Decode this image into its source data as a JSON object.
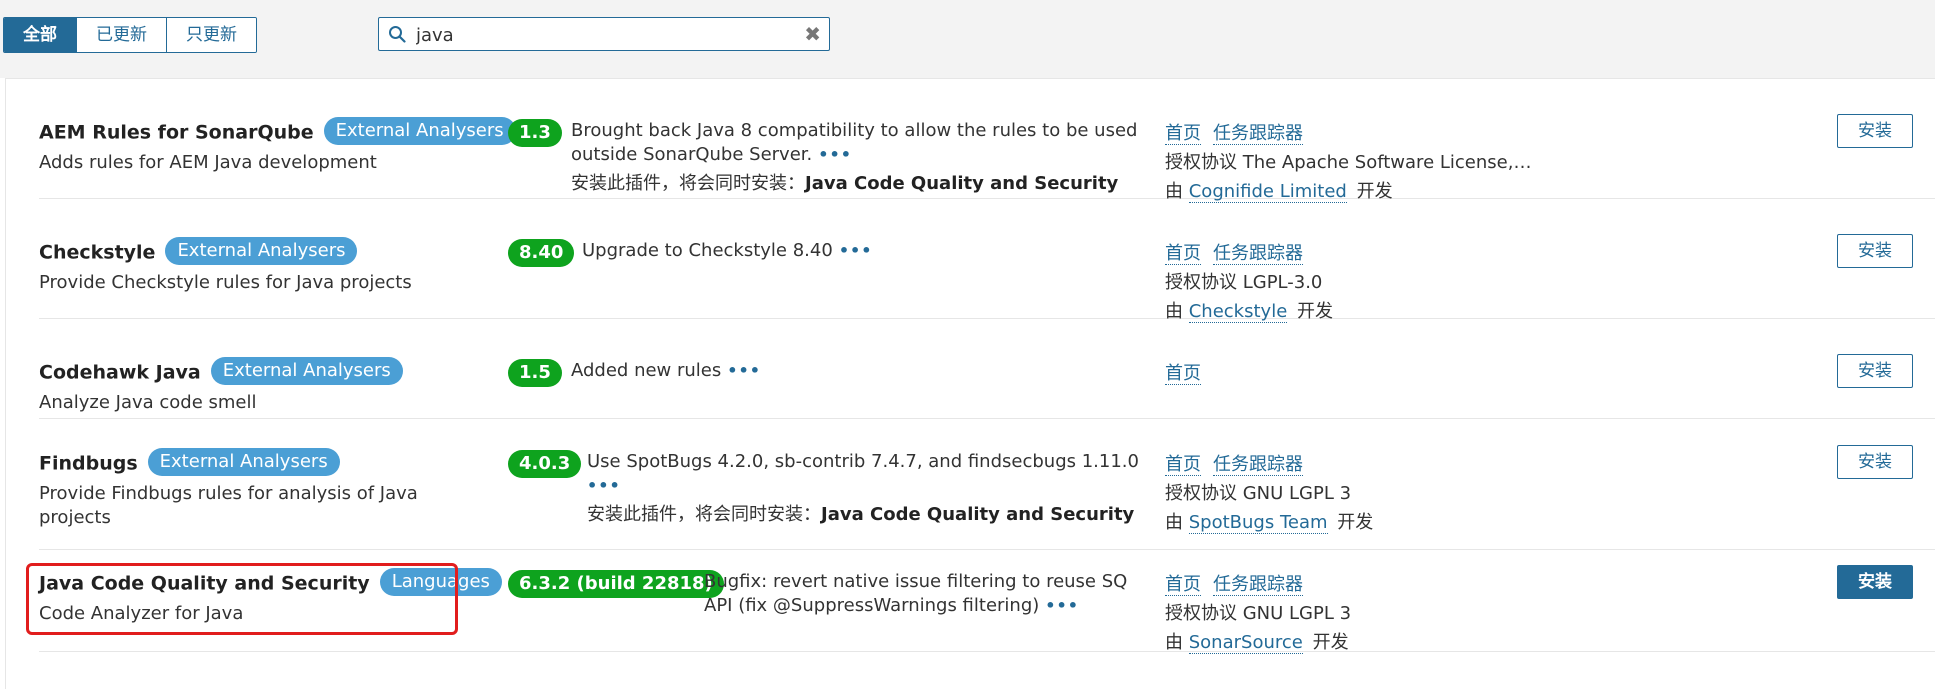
{
  "filter": {
    "tabs": [
      "全部",
      "已更新",
      "只更新"
    ]
  },
  "search": {
    "value": "java",
    "clear_glyph": "✖"
  },
  "plugins": [
    {
      "name": "AEM Rules for SonarQube",
      "tag": "External Analysers",
      "description": "Adds rules for AEM Java development",
      "version": "1.3",
      "notes": "Brought back Java 8 compatibility to allow the rules to be used outside SonarQube Server.",
      "requires_prefix": "安装此插件，将会同时安装：",
      "requires": "Java Code Quality and Security",
      "homepage": "首页",
      "tracker": "任务跟踪器",
      "license": "授权协议 The Apache Software License,…",
      "by_prefix": "由",
      "developer": "Cognifide Limited",
      "by_suffix": "开发",
      "install": "安装"
    },
    {
      "name": "Checkstyle",
      "tag": "External Analysers",
      "description": "Provide Checkstyle rules for Java projects",
      "version": "8.40",
      "notes": "Upgrade to Checkstyle 8.40",
      "homepage": "首页",
      "tracker": "任务跟踪器",
      "license": "授权协议 LGPL-3.0",
      "by_prefix": "由",
      "developer": "Checkstyle",
      "by_suffix": "开发",
      "install": "安装"
    },
    {
      "name": "Codehawk Java",
      "tag": "External Analysers",
      "description": "Analyze Java code smell",
      "version": "1.5",
      "notes": "Added new rules",
      "homepage": "首页",
      "install": "安装"
    },
    {
      "name": "Findbugs",
      "tag": "External Analysers",
      "description": "Provide Findbugs rules for analysis of Java projects",
      "version": "4.0.3",
      "notes": "Use SpotBugs 4.2.0, sb-contrib 7.4.7, and findsecbugs 1.11.0",
      "requires_prefix": "安装此插件，将会同时安装：",
      "requires": "Java Code Quality and Security",
      "homepage": "首页",
      "tracker": "任务跟踪器",
      "license": "授权协议 GNU LGPL 3",
      "by_prefix": "由",
      "developer": "SpotBugs Team",
      "by_suffix": "开发",
      "install": "安装"
    },
    {
      "name": "Java Code Quality and Security",
      "tag": "Languages",
      "description": "Code Analyzer for Java",
      "version": "6.3.2 (build 22818)",
      "notes": "Bugfix: revert native issue filtering to reuse SQ API (fix @SuppressWarnings filtering)",
      "homepage": "首页",
      "tracker": "任务跟踪器",
      "license": "授权协议 GNU LGPL 3",
      "by_prefix": "由",
      "developer": "SonarSource",
      "by_suffix": "开发",
      "install": "安装"
    }
  ],
  "more_glyph": "•••",
  "colors": {
    "primary": "#236a97",
    "tag": "#4b9fd5",
    "version": "#0ea31e",
    "highlight": "#e11d1d"
  }
}
